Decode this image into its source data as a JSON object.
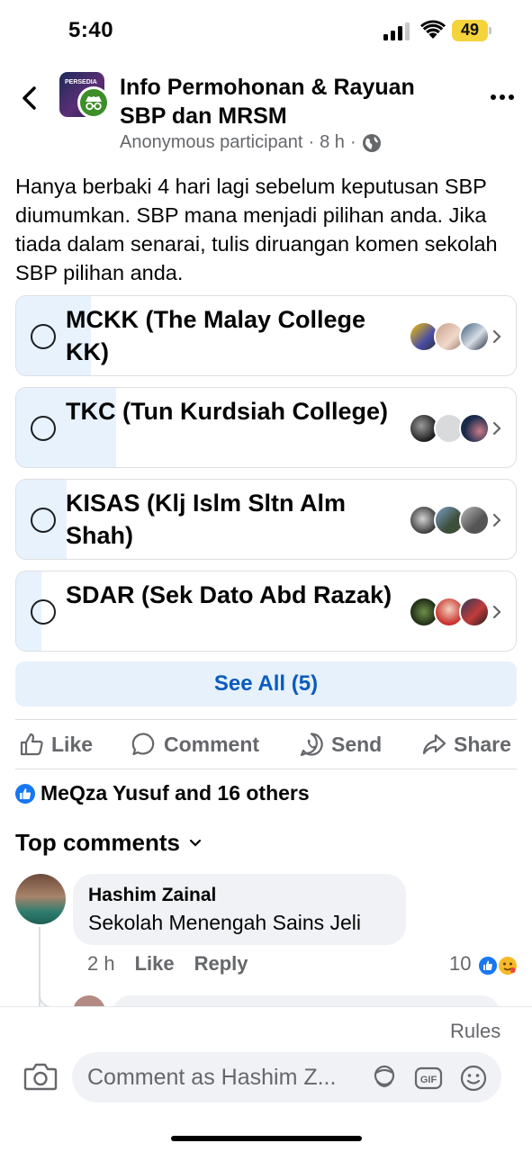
{
  "status_bar": {
    "time": "5:40",
    "battery": "49"
  },
  "header": {
    "group_title_line1": "Info Permohonan & Rayuan",
    "group_title_line2": "SBP dan MRSM",
    "author": "Anonymous participant",
    "separator": "·",
    "time": "8 h",
    "separator2": "·",
    "privacy_icon": "globe-icon",
    "group_avatar_text": "PERSEDIA"
  },
  "post": {
    "text": "Hanya berbaki 4 hari lagi sebelum keputusan SBP diumumkan. SBP mana menjadi pilihan anda. Jika tiada dalam senarai, tulis diruangan komen sekolah SBP pilihan anda."
  },
  "poll": {
    "options": [
      {
        "label": "MCKK (The Malay College KK)",
        "fill": 0.15
      },
      {
        "label": "TKC (Tun Kurdsiah College)",
        "fill": 0.2
      },
      {
        "label": "KISAS (Klj Islm Sltn Alm Shah)",
        "fill": 0.1
      },
      {
        "label": "SDAR (Sek Dato Abd Razak)",
        "fill": 0.05
      }
    ],
    "see_all": "See All (5)"
  },
  "actions": {
    "like": "Like",
    "comment": "Comment",
    "send": "Send",
    "share": "Share"
  },
  "reactions": {
    "summary": "MeQza Yusuf and 16 others"
  },
  "comments": {
    "heading": "Top comments",
    "items": [
      {
        "name": "Hashim Zainal",
        "text": "Sekolah Menengah Sains Jeli",
        "time": "2 h",
        "like": "Like",
        "reply": "Reply",
        "reaction_count": "10"
      }
    ]
  },
  "composer": {
    "rules": "Rules",
    "placeholder": "Comment as Hashim Z..."
  },
  "colors": {
    "accent": "#1877f2",
    "see_all_text": "#0a5bbd",
    "poll_fill": "#e7f2fd",
    "muted": "#65676b"
  }
}
